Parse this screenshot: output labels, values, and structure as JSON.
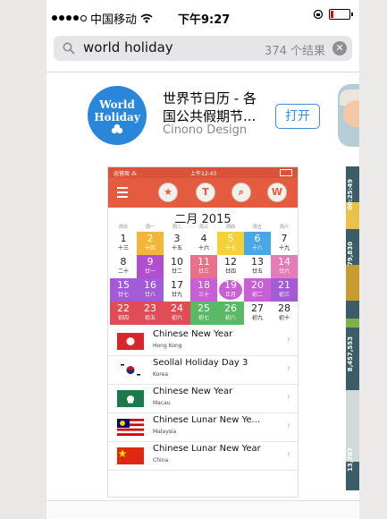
{
  "status_bar": {
    "carrier": "中国移动",
    "time": "下午9:27"
  },
  "search": {
    "query": "world holiday",
    "result_count": "374 个结果"
  },
  "app": {
    "icon_line1": "World",
    "icon_line2": "Holiday",
    "title_line1": "世界节日历 - 各",
    "title_line2": "国公共假期节...",
    "developer": "Cinono Design",
    "open_label": "打开"
  },
  "screenshot": {
    "status_left": "运营商 ⁂",
    "status_time": "上午12:43",
    "toolbar_icons": [
      "star-icon",
      "t-icon",
      "search-icon",
      "world-icon"
    ],
    "toolbar_glyphs": [
      "★",
      "T",
      "⌕",
      "W"
    ],
    "month_title": "二月 2015",
    "weekdays": [
      "周日",
      "周一",
      "周二",
      "周三",
      "周四",
      "周五",
      "周六"
    ],
    "weeks": [
      [
        [
          "1",
          "十三",
          "#ffffff"
        ],
        [
          "2",
          "十四",
          "#f4b63a"
        ],
        [
          "3",
          "十五",
          "#ffffff"
        ],
        [
          "4",
          "十六",
          "#ffffff"
        ],
        [
          "5",
          "十七",
          "#f4d13a"
        ],
        [
          "6",
          "十八",
          "#4aa7e6"
        ],
        [
          "7",
          "十九",
          "#ffffff"
        ]
      ],
      [
        [
          "8",
          "二十",
          "#ffffff"
        ],
        [
          "9",
          "廿一",
          "#b04fcf"
        ],
        [
          "10",
          "廿二",
          "#ffffff"
        ],
        [
          "11",
          "廿三",
          "#e9708a"
        ],
        [
          "12",
          "廿四",
          "#ffffff"
        ],
        [
          "13",
          "廿五",
          "#ffffff"
        ],
        [
          "14",
          "廿六",
          "#e57bb8"
        ]
      ],
      [
        [
          "15",
          "廿七",
          "#a45cd6"
        ],
        [
          "16",
          "廿八",
          "#a45cd6"
        ],
        [
          "17",
          "廿九",
          "#ffffff"
        ],
        [
          "18",
          "三十",
          "#c85fd4"
        ],
        [
          "19",
          "正月",
          "#c85fd4"
        ],
        [
          "20",
          "初二",
          "#c85fd4"
        ],
        [
          "21",
          "初三",
          "#a45cd6"
        ]
      ],
      [
        [
          "22",
          "初四",
          "#e04d57"
        ],
        [
          "23",
          "初五",
          "#e04d57"
        ],
        [
          "24",
          "初六",
          "#e04d57"
        ],
        [
          "25",
          "初七",
          "#5bb867"
        ],
        [
          "26",
          "初八",
          "#5bb867"
        ],
        [
          "27",
          "初九",
          "#ffffff"
        ],
        [
          "28",
          "初十",
          "#ffffff"
        ]
      ]
    ],
    "holidays": [
      {
        "name": "Chinese New Year",
        "country": "Hong Kong",
        "flag": "hk-flag-icon"
      },
      {
        "name": "Seollal Holiday Day 3",
        "country": "Korea",
        "flag": "kr-flag-icon"
      },
      {
        "name": "Chinese New Year",
        "country": "Macau",
        "flag": "mo-flag-icon"
      },
      {
        "name": "Chinese Lunar New Ye...",
        "country": "Malaysia",
        "flag": "my-flag-icon"
      },
      {
        "name": "Chinese Lunar New Year",
        "country": "China",
        "flag": "cn-flag-icon"
      }
    ]
  },
  "next_app_strip": [
    "00:25:49",
    "79,830",
    "8,457,553",
    "13,367"
  ],
  "colors": {
    "accent": "#3c8ddb",
    "toolbar": "#e45b3f",
    "app_icon": "#2a86d8"
  }
}
